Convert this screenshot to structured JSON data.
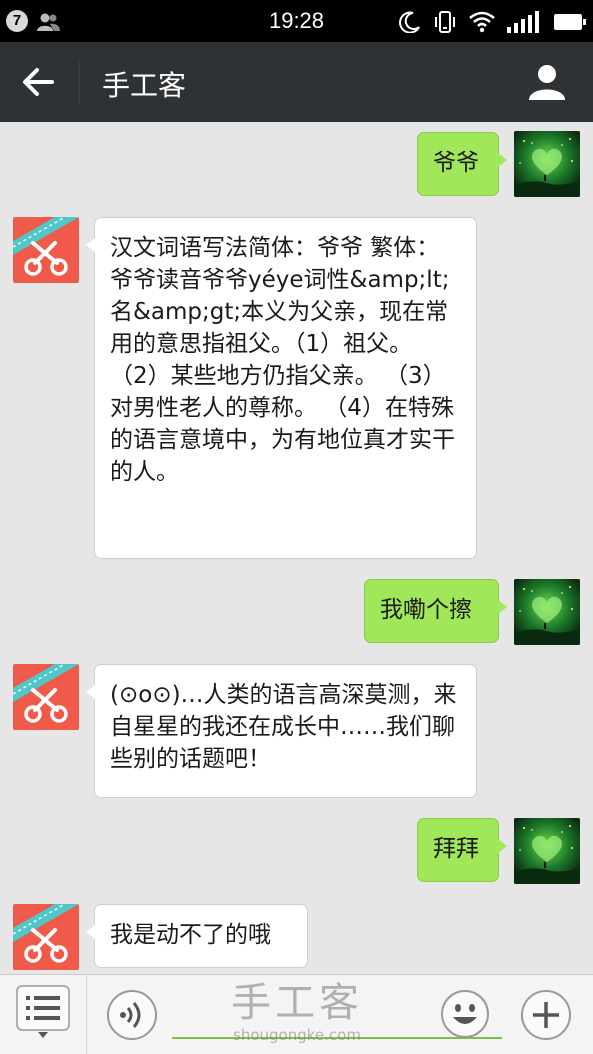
{
  "status_bar": {
    "notification_count": "7",
    "time": "19:28"
  },
  "header": {
    "title": "手工客"
  },
  "messages": [
    {
      "side": "right",
      "text": "爷爷"
    },
    {
      "side": "left",
      "text": "汉文词语写法简体：爷爷 繁体：爷爷读音爷爷yéye词性&amp;lt;名&amp;gt;本义为父亲，现在常用的意思指祖父。（1）祖父。 （2）某些地方仍指父亲。 （3）对男性老人的尊称。 （4）在特殊的语言意境中，为有地位真才实干的人。"
    },
    {
      "side": "right",
      "text": "我嘞个擦"
    },
    {
      "side": "left",
      "text": "(⊙o⊙)…人类的语言高深莫测，来自星星的我还在成长中……我们聊些别的话题吧！"
    },
    {
      "side": "right",
      "text": "拜拜"
    },
    {
      "side": "left",
      "text": "我是动不了的哦"
    }
  ],
  "input": {
    "placeholder": ""
  },
  "watermark": {
    "main": "手工客",
    "sub": "shougongke.com"
  },
  "icons": {
    "status": [
      "notification-badge",
      "person-icon",
      "moon-icon",
      "vibrate-icon",
      "wifi-icon",
      "signal-icon",
      "battery-icon"
    ],
    "header": [
      "back-arrow-icon",
      "profile-icon"
    ],
    "input": [
      "menu-list-icon",
      "voice-icon",
      "emoji-icon",
      "plus-icon"
    ]
  },
  "colors": {
    "nav_bg": "#2f3234",
    "chat_bg": "#e6e6e6",
    "bubble_right": "#a0e75a",
    "bubble_left": "#ffffff",
    "bot_avatar": "#f05a4a",
    "user_avatar": "#0e3a16"
  }
}
